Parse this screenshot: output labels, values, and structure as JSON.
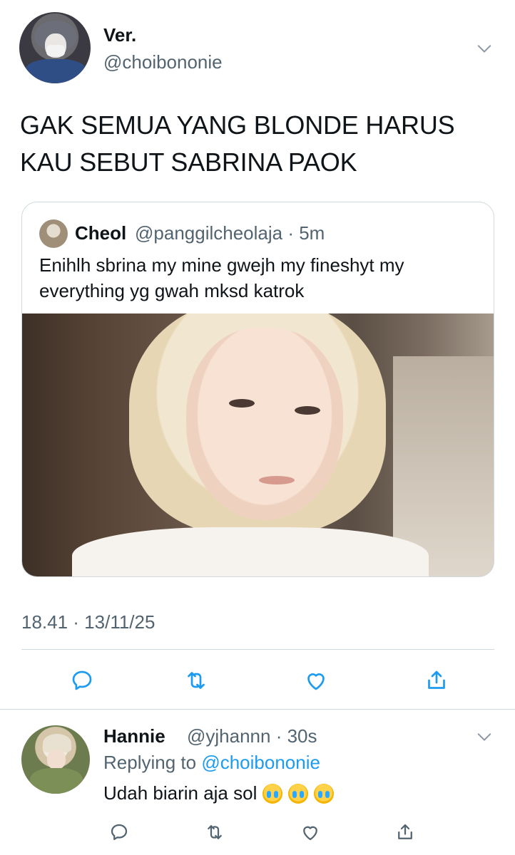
{
  "main_tweet": {
    "display_name": "Ver.",
    "handle": "@choibononie",
    "text_line1": "GAK SEMUA YANG BLONDE HARUS",
    "text_line2": "KAU SEBUT SABRINA PAOK",
    "timestamp": "18.41 · 13/11/25"
  },
  "quoted_tweet": {
    "display_name": "Cheol",
    "handle": "@panggilcheolaja",
    "age": "· 5m",
    "text_line1": "Enihlh sbrina my mine gwejh my fineshyt my",
    "text_line2": "everything yg gwah mksd katrok"
  },
  "reply": {
    "display_name": "Hannie",
    "handle": "@yjhannn",
    "age": "· 30s",
    "replying_prefix": "Replying to",
    "replying_to": "@choibononie",
    "text": "Udah biarin aja sol",
    "emoji_name": "loudly-crying-face"
  },
  "colors": {
    "secondary_text": "#536471",
    "link": "#1d9bf0",
    "divider": "#cfd9de"
  },
  "icons": [
    "chevron-down-icon",
    "reply-icon",
    "retweet-icon",
    "like-icon",
    "share-icon"
  ]
}
